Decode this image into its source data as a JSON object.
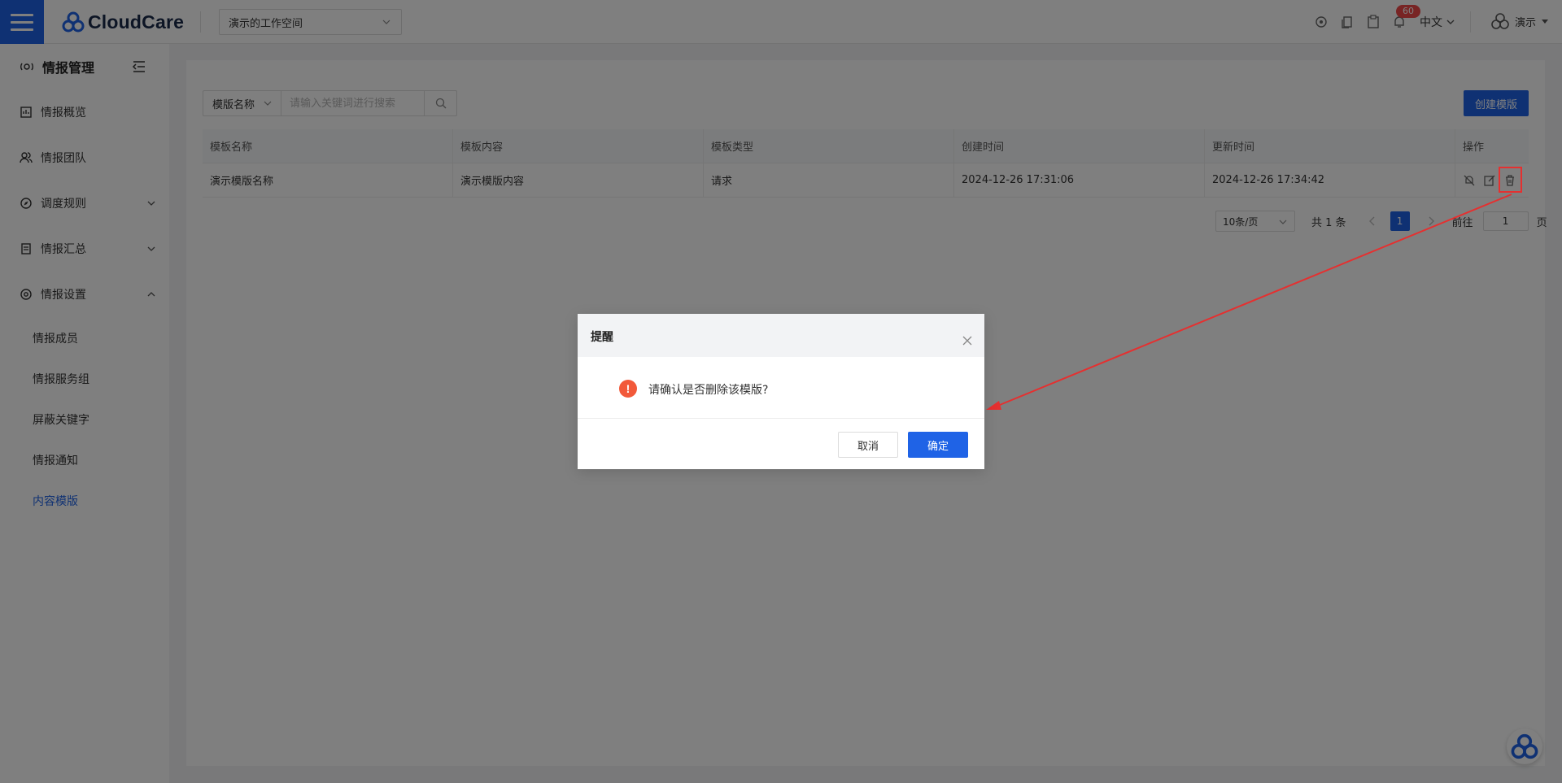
{
  "header": {
    "brand": "CloudCare",
    "workspace": "演示的工作空间",
    "notification_count": "60",
    "language": "中文",
    "user_name": "演示"
  },
  "sidebar": {
    "title": "情报管理",
    "items": [
      {
        "label": "情报概览"
      },
      {
        "label": "情报团队"
      },
      {
        "label": "调度规则"
      },
      {
        "label": "情报汇总"
      },
      {
        "label": "情报设置"
      }
    ],
    "sub_items": [
      {
        "label": "情报成员"
      },
      {
        "label": "情报服务组"
      },
      {
        "label": "屏蔽关键字"
      },
      {
        "label": "情报通知"
      },
      {
        "label": "内容模版"
      }
    ]
  },
  "toolbar": {
    "search_type": "模版名称",
    "search_placeholder": "请输入关键词进行搜索",
    "create_label": "创建模版"
  },
  "table": {
    "columns": [
      "模板名称",
      "模板内容",
      "模板类型",
      "创建时间",
      "更新时间",
      "操作"
    ],
    "rows": [
      {
        "name": "演示模版名称",
        "content": "演示模版内容",
        "type": "请求",
        "created": "2024-12-26 17:31:06",
        "updated": "2024-12-26 17:34:42"
      }
    ]
  },
  "pagination": {
    "page_size": "10条/页",
    "total": "共 1 条",
    "current_page": "1",
    "goto_label": "前往",
    "goto_value": "1",
    "page_unit": "页"
  },
  "dialog": {
    "title": "提醒",
    "message": "请确认是否删除该模版?",
    "cancel_label": "取消",
    "ok_label": "确定"
  },
  "colors": {
    "primary": "#1f63e6",
    "warning": "#f2593a",
    "annotation": "#e53030"
  }
}
